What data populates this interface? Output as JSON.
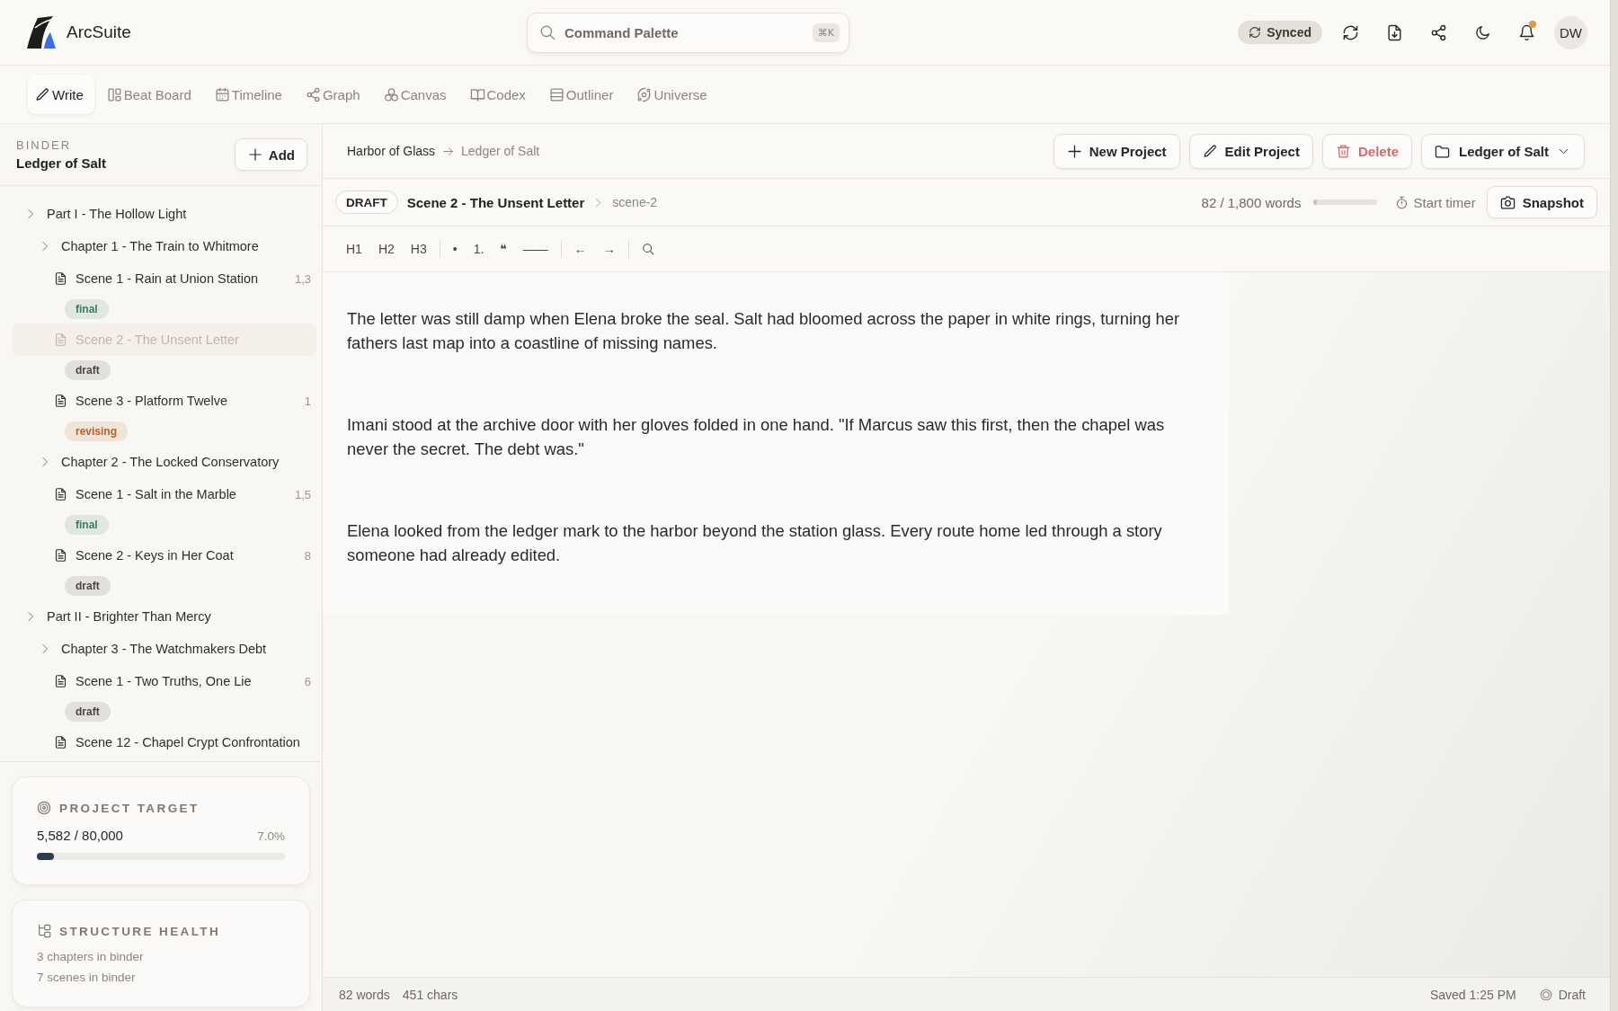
{
  "app": {
    "name": "ArcSuite"
  },
  "command_palette": {
    "placeholder": "Command Palette",
    "shortcut": "⌘K"
  },
  "header": {
    "sync_status": "Synced",
    "has_notifications": true,
    "avatar_initials": "DW"
  },
  "nav_tabs": [
    {
      "label": "Write",
      "selected": true
    },
    {
      "label": "Beat Board",
      "selected": false
    },
    {
      "label": "Timeline",
      "selected": false
    },
    {
      "label": "Graph",
      "selected": false
    },
    {
      "label": "Canvas",
      "selected": false
    },
    {
      "label": "Codex",
      "selected": false
    },
    {
      "label": "Outliner",
      "selected": false
    },
    {
      "label": "Universe",
      "selected": false
    }
  ],
  "binder": {
    "heading": "BINDER",
    "project": "Ledger of Salt",
    "add_button": "Add",
    "tree": [
      {
        "kind": "part",
        "title": "Part I - The Hollow Light",
        "selected": false,
        "children": [
          {
            "kind": "chapter",
            "title": "Chapter 1 - The Train to Whitmore",
            "selected": false,
            "children": [
              {
                "kind": "scene",
                "title": "Scene 1 - Rain at Union Station",
                "words": "1,3",
                "selected": false,
                "tag": {
                  "label": "final",
                  "color": "#3b7d5c"
                }
              },
              {
                "kind": "scene",
                "title": "Scene 2 - The Unsent Letter",
                "selected": true,
                "tag": {
                  "label": "draft",
                  "color": "#4a4744"
                }
              },
              {
                "kind": "scene",
                "title": "Scene 3 - Platform Twelve",
                "words": "1",
                "selected": false,
                "tag": {
                  "label": "revising",
                  "color": "#b5622a"
                }
              }
            ]
          },
          {
            "kind": "chapter",
            "title": "Chapter 2 - The Locked Conservatory",
            "selected": false,
            "children": [
              {
                "kind": "scene",
                "title": "Scene 1 - Salt in the Marble",
                "words": "1,5",
                "selected": false,
                "tag": {
                  "label": "final",
                  "color": "#3b7d5c"
                }
              },
              {
                "kind": "scene",
                "title": "Scene 2 - Keys in Her Coat",
                "words": "8",
                "selected": false,
                "tag": {
                  "label": "draft",
                  "color": "#4a4744"
                }
              }
            ]
          }
        ]
      },
      {
        "kind": "part",
        "title": "Part II - Brighter Than Mercy",
        "selected": false,
        "children": [
          {
            "kind": "chapter",
            "title": "Chapter 3 - The Watchmakers Debt",
            "selected": false,
            "children": [
              {
                "kind": "scene",
                "title": "Scene 1 - Two Truths, One Lie",
                "words": "6",
                "selected": false,
                "tag": {
                  "label": "draft",
                  "color": "#4a4744"
                }
              },
              {
                "kind": "scene",
                "title": "Scene 12 - Chapel Crypt Confrontation",
                "selected": false
              }
            ]
          }
        ]
      }
    ]
  },
  "project_target": {
    "title": "PROJECT TARGET",
    "progress": {
      "text": "5,582 / 80,000",
      "percent": "7.0%",
      "level": 0.07
    }
  },
  "structure_health": {
    "title": "STRUCTURE HEALTH",
    "lines": [
      "3 chapters in binder",
      "7 scenes in binder"
    ]
  },
  "breadcrumb": [
    "Harbor of Glass",
    "Ledger of Salt"
  ],
  "project_actions": [
    {
      "kind": "new",
      "label": "New Project"
    },
    {
      "kind": "edit",
      "label": "Edit Project"
    },
    {
      "kind": "delete",
      "label": "Delete"
    }
  ],
  "project_switcher": {
    "label": "Ledger of Salt"
  },
  "scene": {
    "status": "DRAFT",
    "title": "Scene 2 - The Unsent Letter",
    "slug": "scene-2",
    "word_goal": {
      "text": "82 / 1,800 words",
      "level": 0.046
    },
    "timer": "Start timer",
    "snapshot": "Snapshot"
  },
  "toolbar": {
    "groups": [
      [
        "H1",
        "H2",
        "H3"
      ],
      [
        "•",
        "1.",
        "❝",
        "——"
      ],
      [
        "←",
        "→"
      ]
    ]
  },
  "editor": {
    "paragraphs": [
      "The letter was still damp when Elena broke the seal. Salt had bloomed across the paper in white rings, turning her fathers last map into a coastline of missing names.",
      "Imani stood at the archive door with her gloves folded in one hand. \"If Marcus saw this first, then the chapel was never the secret. The debt was.\"",
      "Elena looked from the ledger mark to the harbor beyond the station glass. Every route home led through a story someone had already edited."
    ]
  },
  "status_bar": {
    "words": "82 words",
    "chars": "451 chars",
    "saved": "Saved 1:25 PM",
    "status": "Draft"
  }
}
